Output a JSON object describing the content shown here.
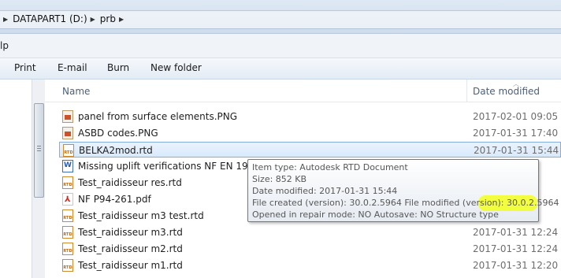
{
  "address": {
    "segments": [
      "DATAPART1 (D:)",
      "prb"
    ]
  },
  "menu": {
    "partial_item": "lp"
  },
  "toolbar": {
    "buttons": [
      "Print",
      "E-mail",
      "Burn",
      "New folder"
    ]
  },
  "columns": {
    "name": "Name",
    "date": "Date modified"
  },
  "files": [
    {
      "name": "panel from surface elements.PNG",
      "date": "2017-02-01 09:05",
      "icon": "png-image-icon"
    },
    {
      "name": "ASBD codes.PNG",
      "date": "2017-01-31 17:40",
      "icon": "png-image-icon"
    },
    {
      "name": "BELKA2mod.rtd",
      "date": "2017-01-31 15:44",
      "icon": "rtd-file-icon",
      "selected": true
    },
    {
      "name": "Missing uplift verifications NF EN 1992-1-",
      "date": "",
      "icon": "word-document-icon"
    },
    {
      "name": "Test_raidisseur res.rtd",
      "date": "",
      "icon": "rtd-file-icon"
    },
    {
      "name": "NF P94-261.pdf",
      "date": "",
      "icon": "pdf-file-icon"
    },
    {
      "name": "Test_raidisseur m3 test.rtd",
      "date": "",
      "icon": "rtd-file-icon"
    },
    {
      "name": "Test_raidisseur m3.rtd",
      "date": "2017-01-31 12:24",
      "icon": "rtd-file-icon"
    },
    {
      "name": "Test_raidisseur m2.rtd",
      "date": "2017-01-31 12:24",
      "icon": "rtd-file-icon"
    },
    {
      "name": "Test_raidisseur m1.rtd",
      "date": "2017-01-31 12:20",
      "icon": "rtd-file-icon"
    }
  ],
  "tooltip": {
    "lines": [
      "Item type: Autodesk RTD Document",
      "Size: 852 KB",
      "Date modified: 2017-01-31 15:44",
      "File created (version): 30.0.2.5964 File modified (version): 30.0.2.5964",
      "Opened in repair mode: NO Autosave: NO Structure type"
    ],
    "highlight_color": "#f2ff2a"
  },
  "rtd_icon_text": "RTD",
  "doc_icon_text": "W",
  "pdf_icon_text": "⅄"
}
